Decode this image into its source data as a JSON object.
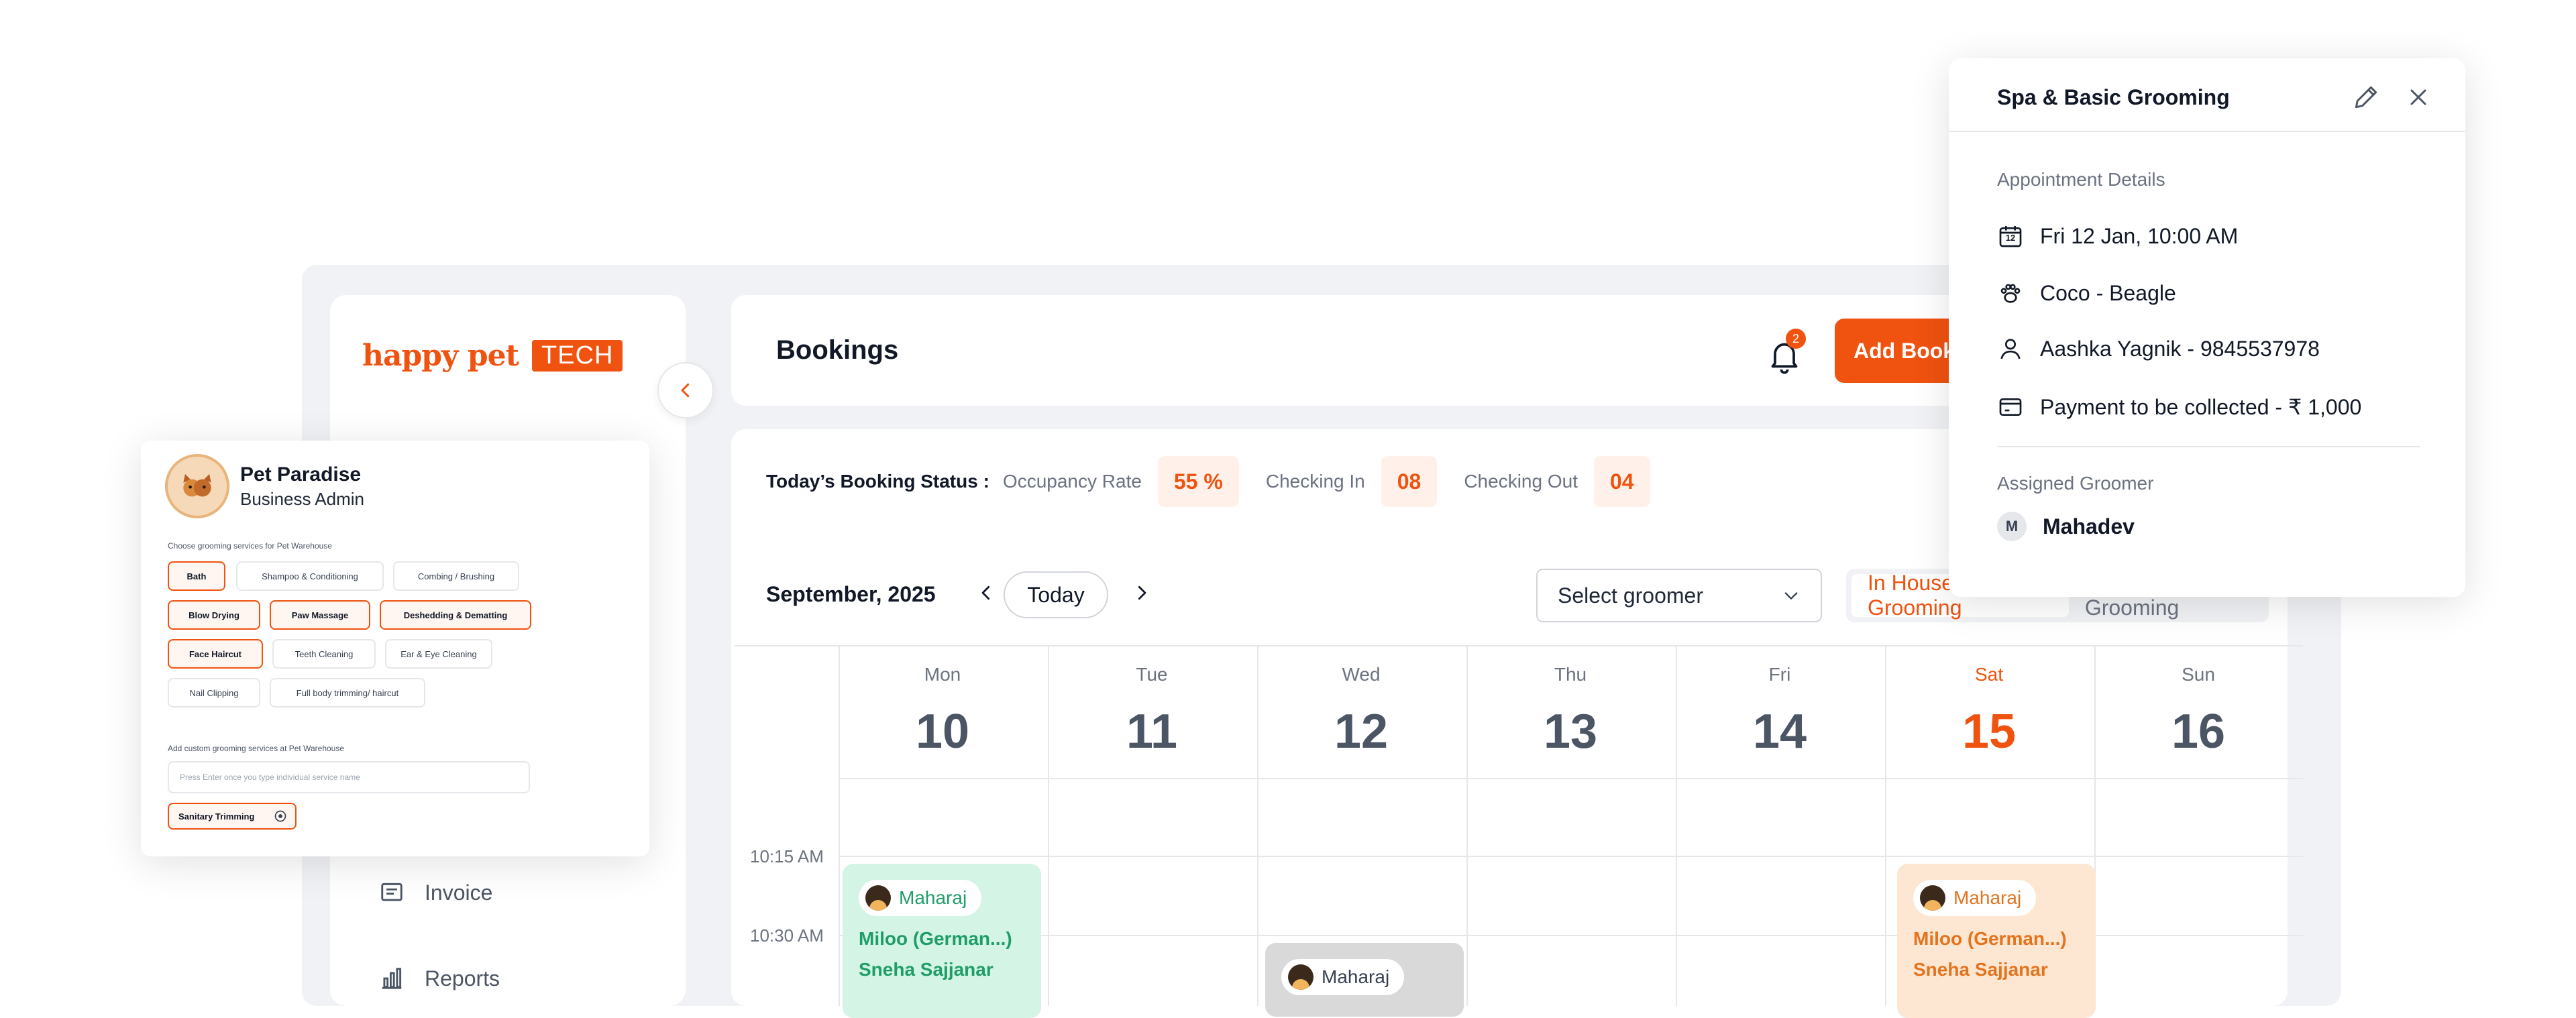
{
  "brand": {
    "name": "happy pet",
    "tech": "TECH",
    "accent": "#f0520f"
  },
  "sidebar": {
    "items": [
      {
        "label": "Invoice",
        "icon": "invoice-icon"
      },
      {
        "label": "Reports",
        "icon": "reports-icon"
      }
    ]
  },
  "header": {
    "title": "Bookings",
    "notifications": "2",
    "add_button": "Add Booking"
  },
  "status": {
    "title": "Today’s Booking Status :",
    "occupancy_label": "Occupancy Rate",
    "occupancy_value": "55 %",
    "checkin_label": "Checking In",
    "checkin_value": "08",
    "checkout_label": "Checking Out",
    "checkout_value": "04"
  },
  "calendar": {
    "month": "September, 2025",
    "today_label": "Today",
    "groomer_placeholder": "Select groomer",
    "toggle_active": "In House Grooming",
    "toggle_inactive": "Mobile Grooming",
    "days": [
      {
        "name": "Mon",
        "num": "10",
        "highlight": false
      },
      {
        "name": "Tue",
        "num": "11",
        "highlight": false
      },
      {
        "name": "Wed",
        "num": "12",
        "highlight": false
      },
      {
        "name": "Thu",
        "num": "13",
        "highlight": false
      },
      {
        "name": "Fri",
        "num": "14",
        "highlight": false
      },
      {
        "name": "Sat",
        "num": "15",
        "highlight": true
      },
      {
        "name": "Sun",
        "num": "16",
        "highlight": false
      }
    ],
    "times": [
      "10:15 AM",
      "10:30 AM"
    ],
    "events": [
      {
        "groomer": "Maharaj",
        "pet": "Miloo (German...)",
        "owner": "Sneha Sajjanar",
        "bg": "#d4f5e6",
        "fg": "#1f9d67"
      },
      {
        "groomer": "Maharaj",
        "bg": "#d9d9d9",
        "fg": "#374151"
      },
      {
        "groomer": "Maharaj",
        "pet": "Miloo (German...)",
        "owner": "Sneha Sajjanar",
        "bg": "#fde7d2",
        "fg": "#e4731e"
      }
    ]
  },
  "pet_card": {
    "name": "Pet Paradise",
    "role": "Business Admin",
    "choose_label": "Choose grooming services for Pet Warehouse",
    "tags": [
      {
        "label": "Bath",
        "selected": true
      },
      {
        "label": "Shampoo & Conditioning",
        "selected": false
      },
      {
        "label": "Combing / Brushing",
        "selected": false
      },
      {
        "label": "Blow Drying",
        "selected": true
      },
      {
        "label": "Paw Massage",
        "selected": true
      },
      {
        "label": "Deshedding & Dematting",
        "selected": true
      },
      {
        "label": "Face Haircut",
        "selected": true
      },
      {
        "label": "Teeth Cleaning",
        "selected": false
      },
      {
        "label": "Ear & Eye Cleaning",
        "selected": false
      },
      {
        "label": "Nail Clipping",
        "selected": false
      },
      {
        "label": "Full body trimming/ haircut",
        "selected": false
      }
    ],
    "custom_label": "Add custom grooming services at Pet Warehouse",
    "custom_placeholder": "Press Enter once you type individual service name",
    "custom_tag": "Sanitary Trimming"
  },
  "appointment": {
    "title": "Spa & Basic Grooming",
    "section": "Appointment Details",
    "date_icon_text": "12",
    "date": "Fri 12 Jan, 10:00 AM",
    "pet": "Coco - Beagle",
    "customer": "Aashka Yagnik - 9845537978",
    "payment": "Payment to be collected - ₹ 1,000",
    "groomer_section": "Assigned Groomer",
    "groomer_initial": "M",
    "groomer": "Mahadev"
  }
}
